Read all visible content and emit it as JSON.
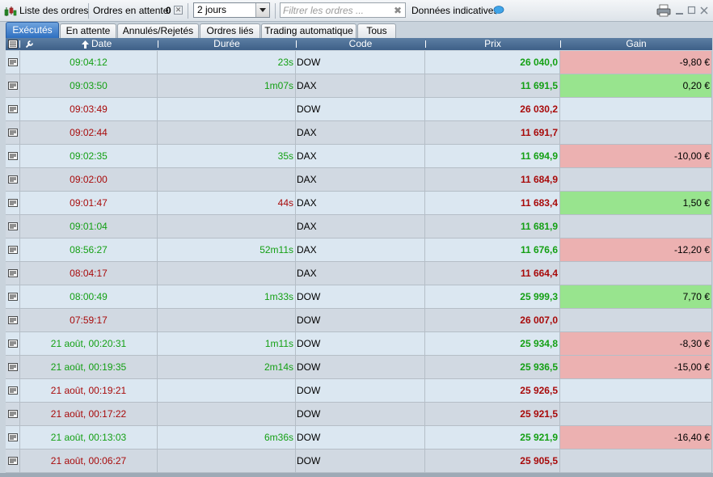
{
  "toolbar": {
    "orders_list_label": "Liste des ordres",
    "pending_label": "Ordres en attente",
    "pending_count": "0",
    "period_value": "2 jours",
    "search_placeholder": "Filtrer les ordres ...",
    "indicative_label": "Données indicatives"
  },
  "tabs": [
    {
      "label": "Exécutés",
      "active": true
    },
    {
      "label": "En attente",
      "active": false
    },
    {
      "label": "Annulés/Rejetés",
      "active": false
    },
    {
      "label": "Ordres liés",
      "active": false
    },
    {
      "label": "Trading automatique",
      "active": false
    },
    {
      "label": "Tous",
      "active": false
    }
  ],
  "columns": {
    "date": "Date",
    "duration": "Durée",
    "code": "Code",
    "price": "Prix",
    "gain": "Gain"
  },
  "colors": {
    "gain_positive": "#98e48e",
    "gain_negative": "#ecb1b1",
    "text_green": "#14a014",
    "text_red": "#a80a0a",
    "tab_active": "#3b7ccc"
  },
  "rows": [
    {
      "date": "09:04:12",
      "duration": "23s",
      "code": "DOW",
      "price": "26 040,0",
      "gain": "-9,80 €",
      "side": "green",
      "gain_sign": "neg"
    },
    {
      "date": "09:03:50",
      "duration": "1m07s",
      "code": "DAX",
      "price": "11 691,5",
      "gain": "0,20 €",
      "side": "green",
      "gain_sign": "pos"
    },
    {
      "date": "09:03:49",
      "duration": "",
      "code": "DOW",
      "price": "26 030,2",
      "gain": "",
      "side": "red",
      "gain_sign": ""
    },
    {
      "date": "09:02:44",
      "duration": "",
      "code": "DAX",
      "price": "11 691,7",
      "gain": "",
      "side": "red",
      "gain_sign": ""
    },
    {
      "date": "09:02:35",
      "duration": "35s",
      "code": "DAX",
      "price": "11 694,9",
      "gain": "-10,00 €",
      "side": "green",
      "gain_sign": "neg"
    },
    {
      "date": "09:02:00",
      "duration": "",
      "code": "DAX",
      "price": "11 684,9",
      "gain": "",
      "side": "red",
      "gain_sign": ""
    },
    {
      "date": "09:01:47",
      "duration": "44s",
      "code": "DAX",
      "price": "11 683,4",
      "gain": "1,50 €",
      "side": "red",
      "gain_sign": "pos"
    },
    {
      "date": "09:01:04",
      "duration": "",
      "code": "DAX",
      "price": "11 681,9",
      "gain": "",
      "side": "green",
      "gain_sign": ""
    },
    {
      "date": "08:56:27",
      "duration": "52m11s",
      "code": "DAX",
      "price": "11 676,6",
      "gain": "-12,20 €",
      "side": "green",
      "gain_sign": "neg"
    },
    {
      "date": "08:04:17",
      "duration": "",
      "code": "DAX",
      "price": "11 664,4",
      "gain": "",
      "side": "red",
      "gain_sign": ""
    },
    {
      "date": "08:00:49",
      "duration": "1m33s",
      "code": "DOW",
      "price": "25 999,3",
      "gain": "7,70 €",
      "side": "green",
      "gain_sign": "pos"
    },
    {
      "date": "07:59:17",
      "duration": "",
      "code": "DOW",
      "price": "26 007,0",
      "gain": "",
      "side": "red",
      "gain_sign": ""
    },
    {
      "date": "21 août, 00:20:31",
      "duration": "1m11s",
      "code": "DOW",
      "price": "25 934,8",
      "gain": "-8,30 €",
      "side": "green",
      "gain_sign": "neg"
    },
    {
      "date": "21 août, 00:19:35",
      "duration": "2m14s",
      "code": "DOW",
      "price": "25 936,5",
      "gain": "-15,00 €",
      "side": "green",
      "gain_sign": "neg"
    },
    {
      "date": "21 août, 00:19:21",
      "duration": "",
      "code": "DOW",
      "price": "25 926,5",
      "gain": "",
      "side": "red",
      "gain_sign": ""
    },
    {
      "date": "21 août, 00:17:22",
      "duration": "",
      "code": "DOW",
      "price": "25 921,5",
      "gain": "",
      "side": "red",
      "gain_sign": ""
    },
    {
      "date": "21 août, 00:13:03",
      "duration": "6m36s",
      "code": "DOW",
      "price": "25 921,9",
      "gain": "-16,40 €",
      "side": "green",
      "gain_sign": "neg"
    },
    {
      "date": "21 août, 00:06:27",
      "duration": "",
      "code": "DOW",
      "price": "25 905,5",
      "gain": "",
      "side": "red",
      "gain_sign": ""
    }
  ]
}
